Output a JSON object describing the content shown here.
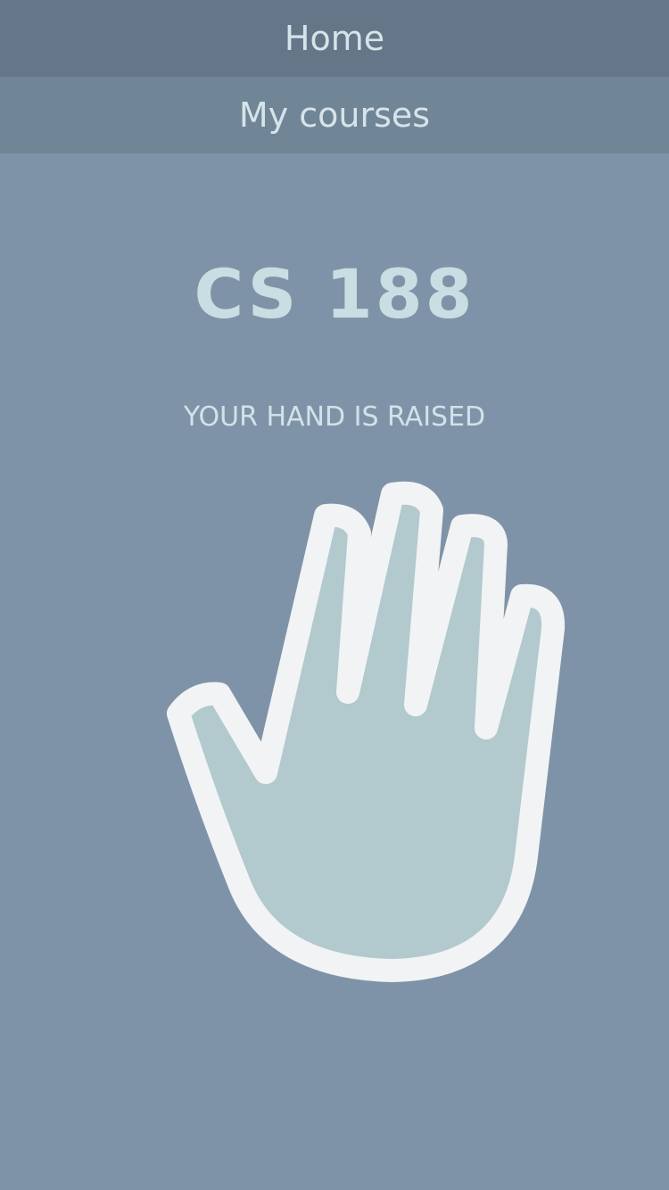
{
  "nav": {
    "home_label": "Home",
    "my_courses_label": "My courses"
  },
  "course": {
    "title": "CS 188"
  },
  "status": {
    "text": "YOUR HAND IS RAISED"
  },
  "hand": {
    "icon": "raised-hand-icon",
    "fill_color": "#b2c9ce",
    "outline_color": "#f1f3f5"
  },
  "colors": {
    "background": "#7f93a8",
    "nav_home_bg": "#647687",
    "nav_courses_bg": "#708596",
    "text": "#d2e2e8"
  }
}
